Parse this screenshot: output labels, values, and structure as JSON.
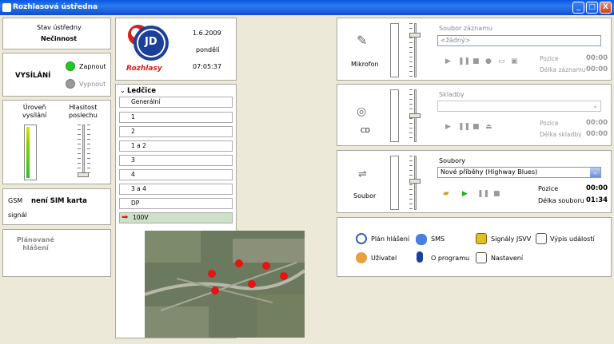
{
  "window": {
    "title": "Rozhlasová ústředna",
    "minimize": "_",
    "maximize": "□",
    "close": "X"
  },
  "status": {
    "label": "Stav ústředny",
    "value": "Nečinnost"
  },
  "broadcast": {
    "title": "VYSÍLÁNÍ",
    "on_label": "Zapnout",
    "off_label": "Vypnout",
    "on_color": "#22c922",
    "off_color": "#9a9a9a"
  },
  "levels": {
    "send_label": "Úroveň\nvysílání",
    "listen_label": "Hlasitost\nposlechu",
    "send_level": 0.95
  },
  "gsm": {
    "label": "GSM",
    "sim": "není SIM karta",
    "signal_label": "signál"
  },
  "planned": {
    "label": "Plánované\nhlášení"
  },
  "brand": {
    "logo_text": "JD",
    "logo_sub": "Rozhlasy"
  },
  "clock": {
    "date": "1.6.2009",
    "weekday": "pondělí",
    "time": "07:05:37"
  },
  "location": {
    "title": "Ledčice",
    "items": [
      "Generální",
      "1",
      "2",
      "1 a 2",
      "3",
      "4",
      "3 a 4",
      "DP",
      "100V"
    ],
    "selected_index": 8
  },
  "microphone": {
    "label": "Mikrofon",
    "file_label": "Soubor záznamu",
    "file_placeholder": "<žádný>",
    "pos_label": "Pozice",
    "pos_value": "00:00",
    "len_label": "Délka záznamu",
    "len_value": "00:00"
  },
  "cd": {
    "label": "CD",
    "tracks_label": "Skladby",
    "pos_label": "Pozice",
    "pos_value": "00:00",
    "len_label": "Délka skladby",
    "len_value": "00:00"
  },
  "file": {
    "label": "Soubor",
    "files_label": "Soubory",
    "files_selected": "Nové příběhy (Highway Blues)",
    "pos_label": "Pozice",
    "pos_value": "00:00",
    "len_label": "Délka souboru",
    "len_value": "01:34"
  },
  "menu": {
    "plan": "Plán hlášení",
    "sms": "SMS",
    "signals": "Signály JSVV",
    "log": "Výpis událostí",
    "user": "Uživatel",
    "about": "O programu",
    "settings": "Nastavení"
  }
}
